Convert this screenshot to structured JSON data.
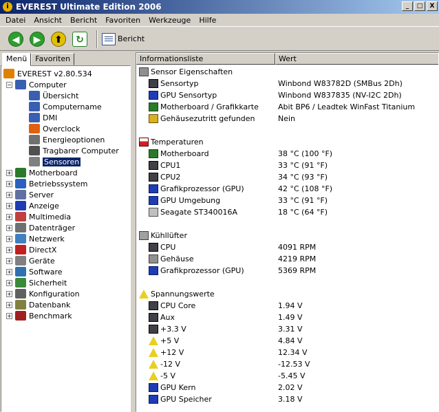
{
  "window": {
    "title": "EVEREST Ultimate Edition 2006",
    "minimize": "_",
    "maximize": "□",
    "close": "X"
  },
  "menu": [
    "Datei",
    "Ansicht",
    "Bericht",
    "Favoriten",
    "Werkzeuge",
    "Hilfe"
  ],
  "toolbar": {
    "back": "◀",
    "forward": "▶",
    "up": "⬆",
    "refresh": "↻",
    "report_label": "Bericht"
  },
  "tabs": [
    "Menü",
    "Favoriten"
  ],
  "tree": [
    {
      "label": "EVEREST v2.80.534",
      "icon": "info-icon",
      "indent": 0,
      "expander": ""
    },
    {
      "label": "Computer",
      "icon": "computer-icon",
      "indent": 1,
      "expander": "−"
    },
    {
      "label": "Übersicht",
      "icon": "computer-icon",
      "indent": 2,
      "expander": ""
    },
    {
      "label": "Computername",
      "icon": "computer-icon",
      "indent": 2,
      "expander": ""
    },
    {
      "label": "DMI",
      "icon": "computer-icon",
      "indent": 2,
      "expander": ""
    },
    {
      "label": "Overclock",
      "icon": "flame-icon",
      "indent": 2,
      "expander": ""
    },
    {
      "label": "Energieoptionen",
      "icon": "power-icon",
      "indent": 2,
      "expander": ""
    },
    {
      "label": "Tragbarer Computer",
      "icon": "laptop-icon",
      "indent": 2,
      "expander": ""
    },
    {
      "label": "Sensoren",
      "icon": "sensor-icon",
      "indent": 2,
      "expander": "",
      "selected": true
    },
    {
      "label": "Motherboard",
      "icon": "motherboard-icon",
      "indent": 1,
      "expander": "+"
    },
    {
      "label": "Betriebssystem",
      "icon": "windows-icon",
      "indent": 1,
      "expander": "+"
    },
    {
      "label": "Server",
      "icon": "server-icon",
      "indent": 1,
      "expander": "+"
    },
    {
      "label": "Anzeige",
      "icon": "display-icon",
      "indent": 1,
      "expander": "+"
    },
    {
      "label": "Multimedia",
      "icon": "multimedia-icon",
      "indent": 1,
      "expander": "+"
    },
    {
      "label": "Datenträger",
      "icon": "drive-icon",
      "indent": 1,
      "expander": "+"
    },
    {
      "label": "Netzwerk",
      "icon": "network-icon",
      "indent": 1,
      "expander": "+"
    },
    {
      "label": "DirectX",
      "icon": "directx-icon",
      "indent": 1,
      "expander": "+"
    },
    {
      "label": "Geräte",
      "icon": "devices-icon",
      "indent": 1,
      "expander": "+"
    },
    {
      "label": "Software",
      "icon": "software-icon",
      "indent": 1,
      "expander": "+"
    },
    {
      "label": "Sicherheit",
      "icon": "shield-icon",
      "indent": 1,
      "expander": "+"
    },
    {
      "label": "Konfiguration",
      "icon": "config-icon",
      "indent": 1,
      "expander": "+"
    },
    {
      "label": "Datenbank",
      "icon": "database-icon",
      "indent": 1,
      "expander": "+"
    },
    {
      "label": "Benchmark",
      "icon": "hourglass-icon",
      "indent": 1,
      "expander": "+"
    }
  ],
  "list": {
    "col_info": "Informationsliste",
    "col_value": "Wert",
    "rows": [
      {
        "type": "group",
        "label": "Sensor Eigenschaften",
        "icon": "gen"
      },
      {
        "label": "Sensortyp",
        "value": "Winbond W83782D  (SMBus 2Dh)",
        "icon": "chip"
      },
      {
        "label": "GPU Sensortyp",
        "value": "Winbond W837835  (NV-I2C 2Dh)",
        "icon": "mon"
      },
      {
        "label": "Motherboard / Grafikkarte",
        "value": "Abit BP6 / Leadtek WinFast Titanium",
        "icon": "board"
      },
      {
        "label": "Gehäusezutritt gefunden",
        "value": "Nein",
        "icon": "lock"
      },
      {
        "type": "blank"
      },
      {
        "type": "group",
        "label": "Temperaturen",
        "icon": "therm"
      },
      {
        "label": "Motherboard",
        "value": "38 °C  (100 °F)",
        "icon": "board"
      },
      {
        "label": "CPU1",
        "value": "33 °C  (91 °F)",
        "icon": "chip"
      },
      {
        "label": "CPU2",
        "value": "34 °C  (93 °F)",
        "icon": "chip"
      },
      {
        "label": "Grafikprozessor (GPU)",
        "value": "42 °C  (108 °F)",
        "icon": "mon"
      },
      {
        "label": "GPU Umgebung",
        "value": "33 °C  (91 °F)",
        "icon": "mon"
      },
      {
        "label": "Seagate ST340016A",
        "value": "18 °C  (64 °F)",
        "icon": "disk"
      },
      {
        "type": "blank"
      },
      {
        "type": "group",
        "label": "Kühllüfter",
        "icon": "fan"
      },
      {
        "label": "CPU",
        "value": "4091 RPM",
        "icon": "chip"
      },
      {
        "label": "Gehäuse",
        "value": "4219 RPM",
        "icon": "gen"
      },
      {
        "label": "Grafikprozessor (GPU)",
        "value": "5369 RPM",
        "icon": "mon"
      },
      {
        "type": "blank"
      },
      {
        "type": "group",
        "label": "Spannungswerte",
        "icon": "warn"
      },
      {
        "label": "CPU Core",
        "value": "1.94 V",
        "icon": "chip"
      },
      {
        "label": "Aux",
        "value": "1.49 V",
        "icon": "chip"
      },
      {
        "label": "+3.3 V",
        "value": "3.31 V",
        "icon": "chip"
      },
      {
        "label": "+5 V",
        "value": "4.84 V",
        "icon": "warn"
      },
      {
        "label": "+12 V",
        "value": "12.34 V",
        "icon": "warn"
      },
      {
        "label": "-12 V",
        "value": "-12.53 V",
        "icon": "warn"
      },
      {
        "label": "-5 V",
        "value": "-5.45 V",
        "icon": "warn"
      },
      {
        "label": "GPU Kern",
        "value": "2.02 V",
        "icon": "mon"
      },
      {
        "label": "GPU Speicher",
        "value": "3.18 V",
        "icon": "mon"
      }
    ]
  }
}
